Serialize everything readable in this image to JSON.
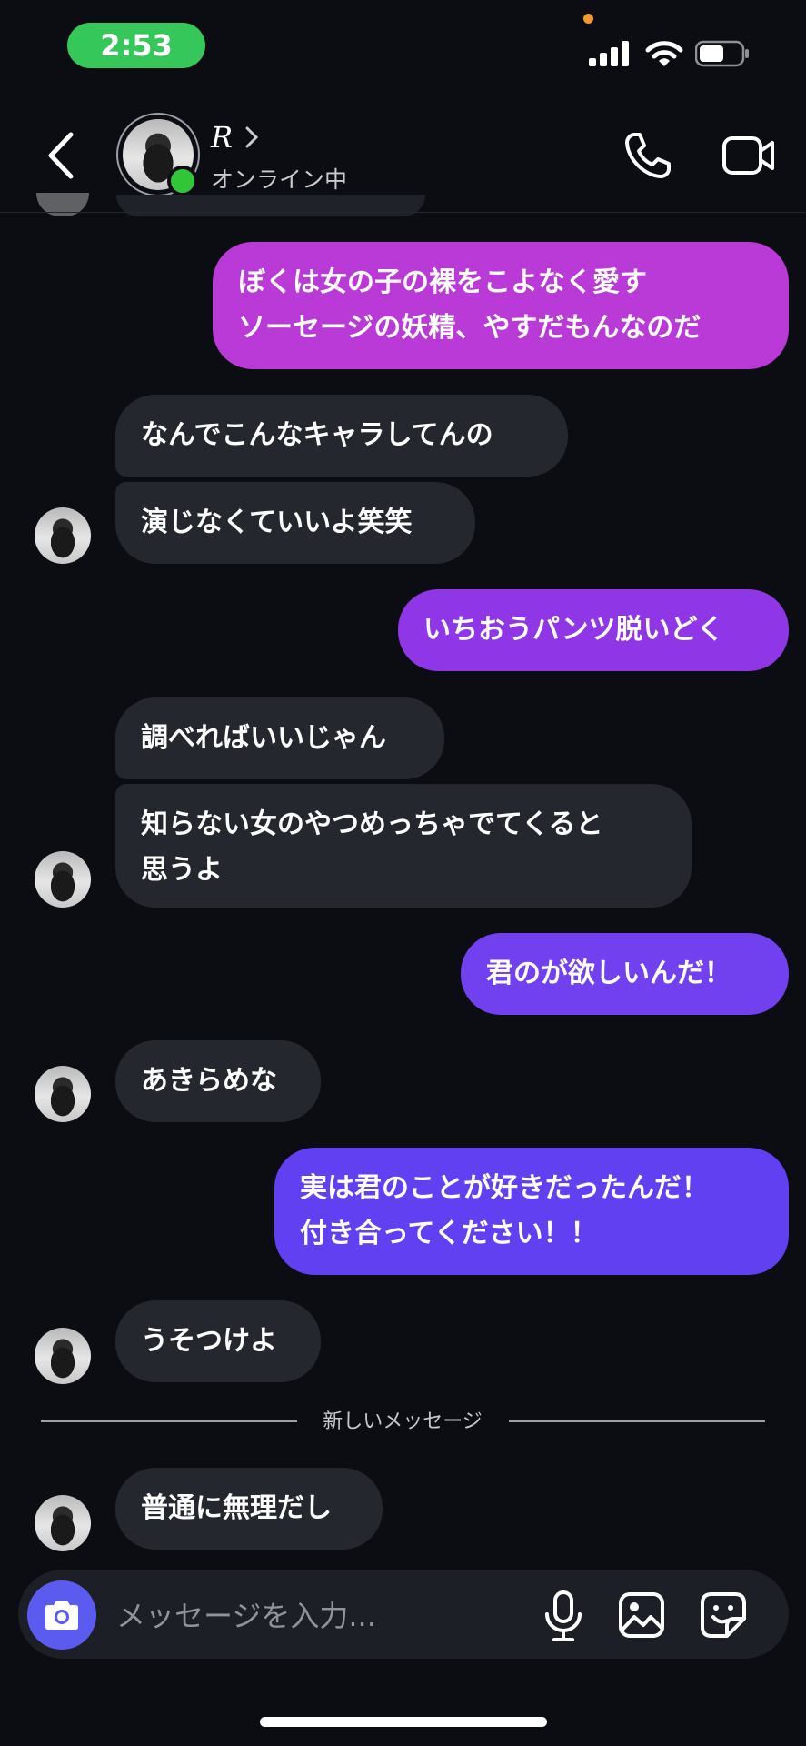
{
  "status_bar": {
    "time": "2:53"
  },
  "header": {
    "contact_name": "R",
    "contact_status": "オンライン中"
  },
  "colors": {
    "background": "#0b0d12",
    "incoming_bubble": "#24272d",
    "outgoing_gradient_top": "#b93ad6",
    "outgoing_gradient_bottom": "#5f45f3",
    "online": "#31c637",
    "time_pill": "#35c759"
  },
  "messages": [
    {
      "side": "out",
      "text": "ぼくは女の子の裸をこよなく愛す\nソーセージの妖精、やすだもんなのだ"
    },
    {
      "side": "in",
      "text": "なんでこんなキャラしてんの"
    },
    {
      "side": "in",
      "text": "演じなくていいよ笑笑"
    },
    {
      "side": "out",
      "text": "いちおうパンツ脱いどく"
    },
    {
      "side": "in",
      "text": "調べればいいじゃん"
    },
    {
      "side": "in",
      "text": "知らない女のやつめっちゃでてくると\n思うよ"
    },
    {
      "side": "out",
      "text": "君のが欲しいんだ！"
    },
    {
      "side": "in",
      "text": "あきらめな"
    },
    {
      "side": "out",
      "text": "実は君のことが好きだったんだ！\n付き合ってください！！"
    },
    {
      "side": "in",
      "text": "うそつけよ"
    },
    {
      "side": "in",
      "text": "普通に無理だし"
    }
  ],
  "divider": {
    "label": "新しいメッセージ"
  },
  "composer": {
    "placeholder": "メッセージを入力...",
    "icons": [
      "camera-icon",
      "microphone-icon",
      "image-icon",
      "sticker-icon"
    ]
  }
}
